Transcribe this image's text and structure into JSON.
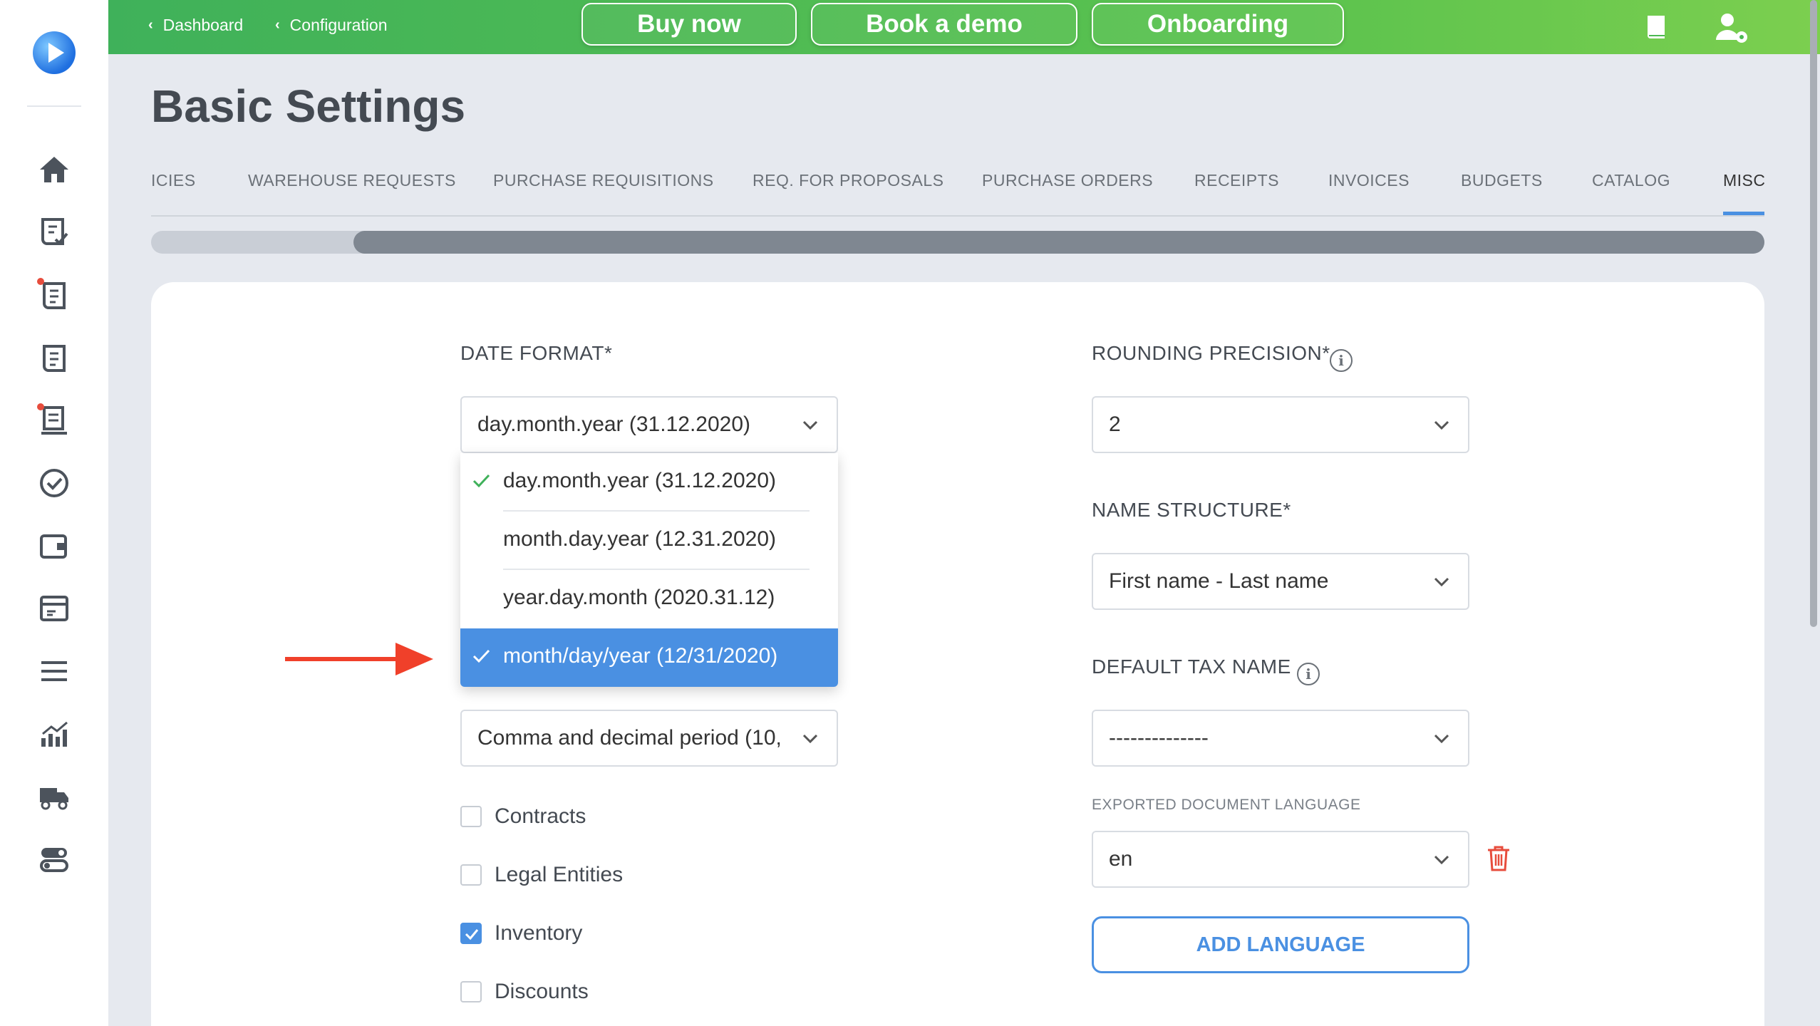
{
  "breadcrumbs": [
    {
      "label": "Dashboard"
    },
    {
      "label": "Configuration"
    }
  ],
  "top_buttons": {
    "buy_now": "Buy now",
    "book_demo": "Book a demo",
    "onboarding": "Onboarding"
  },
  "page": {
    "title": "Basic Settings"
  },
  "tabs": [
    {
      "label": "ICIES"
    },
    {
      "label": "WAREHOUSE REQUESTS"
    },
    {
      "label": "PURCHASE REQUISITIONS"
    },
    {
      "label": "REQ. FOR PROPOSALS"
    },
    {
      "label": "PURCHASE ORDERS"
    },
    {
      "label": "RECEIPTS"
    },
    {
      "label": "INVOICES"
    },
    {
      "label": "BUDGETS"
    },
    {
      "label": "CATALOG"
    },
    {
      "label": "MISC",
      "active": true
    }
  ],
  "date_format": {
    "label": "DATE FORMAT*",
    "value": "day.month.year (31.12.2020)",
    "options": [
      {
        "label": "day.month.year (31.12.2020)",
        "checked": true
      },
      {
        "label": "month.day.year (12.31.2020)"
      },
      {
        "label": "year.day.month (2020.31.12)"
      },
      {
        "label": "month/day/year (12/31/2020)",
        "checked": true,
        "highlighted": true
      }
    ]
  },
  "number_format": {
    "value": "Comma and decimal period (10,…"
  },
  "modules": [
    {
      "label": "Contracts",
      "checked": false
    },
    {
      "label": "Legal Entities",
      "checked": false
    },
    {
      "label": "Inventory",
      "checked": true
    },
    {
      "label": "Discounts",
      "checked": false
    }
  ],
  "rounding_precision": {
    "label": "ROUNDING PRECISION*",
    "value": "2"
  },
  "name_structure": {
    "label": "NAME STRUCTURE*",
    "value": "First name - Last name"
  },
  "default_tax_name": {
    "label": "DEFAULT TAX NAME",
    "value": "--------------"
  },
  "exported_language": {
    "label": "EXPORTED DOCUMENT LANGUAGE",
    "value": "en"
  },
  "add_language": {
    "label": "ADD LANGUAGE"
  },
  "colors": {
    "topbar_green": "#4cb953",
    "accent_blue": "#4a90e2",
    "danger_red": "#e74c3c",
    "arrow_red": "#f0402a"
  },
  "icons": [
    "home-icon",
    "requests-icon",
    "requisitions-icon",
    "proposals-icon",
    "orders-icon",
    "approvals-icon",
    "wallet-icon",
    "invoices-icon",
    "menu-icon",
    "reports-icon",
    "delivery-icon",
    "settings-icon",
    "book-icon",
    "user-settings-icon",
    "trash-icon",
    "info-icon",
    "chevron-down-icon",
    "check-icon"
  ]
}
